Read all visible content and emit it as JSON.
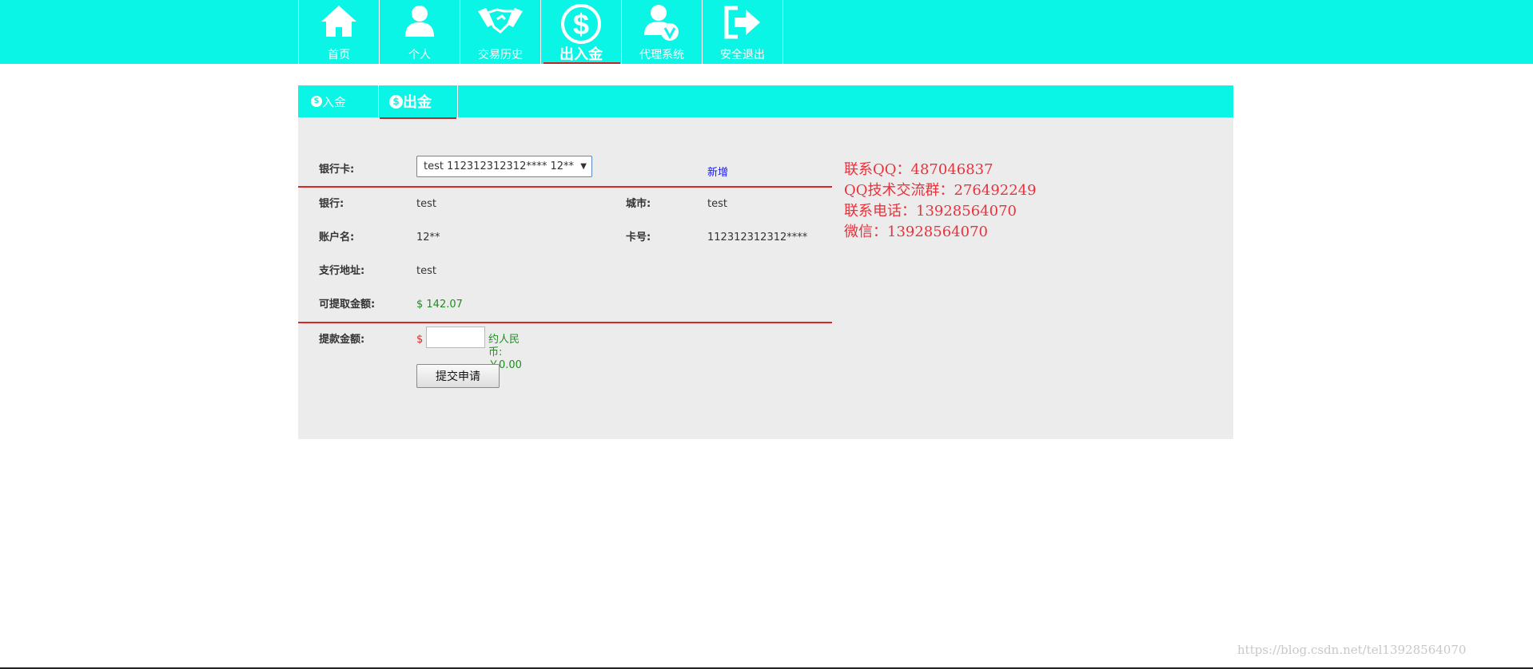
{
  "nav": {
    "items": [
      {
        "label": "首页",
        "icon": "home-icon"
      },
      {
        "label": "个人",
        "icon": "user-icon"
      },
      {
        "label": "交易历史",
        "icon": "handshake-icon"
      },
      {
        "label": "出入金",
        "icon": "dollar-circle-icon",
        "active": true
      },
      {
        "label": "代理系统",
        "icon": "agent-icon"
      },
      {
        "label": "安全退出",
        "icon": "logout-icon"
      }
    ],
    "accent": "#0af5e6",
    "active_underline": "#b22a2a"
  },
  "tabs": {
    "deposit": {
      "icon_glyph": "$",
      "label": "入金"
    },
    "withdraw": {
      "icon_glyph": "$",
      "label": "出金",
      "active": true
    }
  },
  "form": {
    "bank_card_label": "银行卡:",
    "bank_card_selected": "test 112312312312**** 12**",
    "add_link": "新增",
    "bank_label": "银行:",
    "bank_value": "test",
    "city_label": "城市:",
    "city_value": "test",
    "account_name_label": "账户名:",
    "account_name_value": "12**",
    "card_no_label": "卡号:",
    "card_no_value": "112312312312****",
    "branch_label": "支行地址:",
    "branch_value": "test",
    "available_label": "可提取金额:",
    "available_value": "$ 142.07",
    "withdraw_amount_label": "提款金额:",
    "currency_symbol": "$",
    "amount_value": "",
    "cny_estimate": "约人民币:￥0.00",
    "submit_label": "提交申请"
  },
  "contact": {
    "qq": "联系QQ：487046837",
    "qq_group": "QQ技术交流群：276492249",
    "phone": "联系电话：13928564070",
    "wechat": "微信：13928564070"
  },
  "watermark": "https://blog.csdn.net/tel13928564070"
}
